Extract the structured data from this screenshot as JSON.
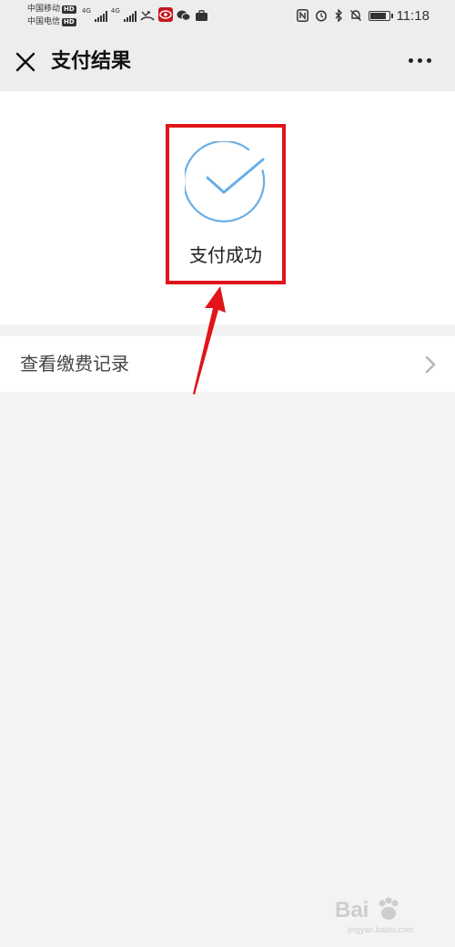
{
  "status_bar": {
    "carrier_1": "中国移动",
    "carrier_2": "中国电信",
    "hd": "HD",
    "net_1": "4G",
    "net_2": "4G",
    "time": "11:18"
  },
  "nav": {
    "title": "支付结果"
  },
  "result": {
    "status_text": "支付成功",
    "accent_color": "#6aaee5"
  },
  "record_row": {
    "label": "查看缴费记录"
  },
  "annotation": {
    "highlight_color": "#e0141a"
  },
  "watermark": {
    "text": "Bai",
    "sub": "jingyan.baidu.com"
  }
}
